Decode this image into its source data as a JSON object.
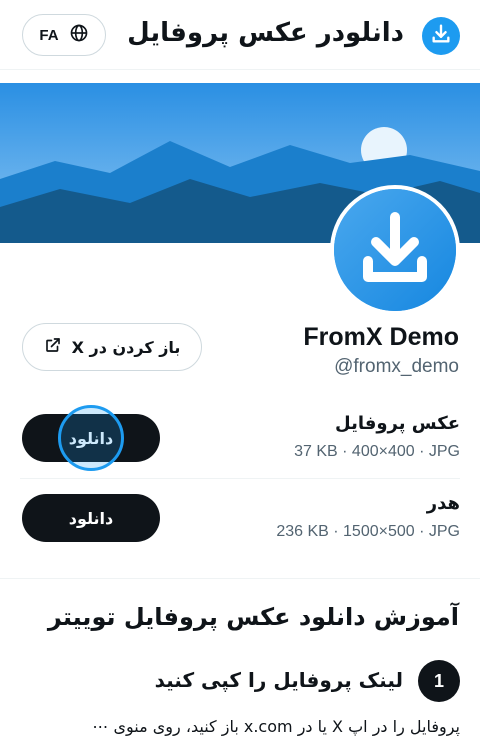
{
  "header": {
    "lang_label": "FA",
    "lang_icon": "globe-icon",
    "title": "دانلودر عکس پروفایل",
    "logo_icon": "download-icon"
  },
  "profile": {
    "name": "FromX Demo",
    "handle": "@fromx_demo",
    "open_button_label": "باز کردن در X",
    "open_button_icon": "external-link-icon"
  },
  "downloads": [
    {
      "title": "عکس پروفایل",
      "meta": "37 KB · 400×400 · JPG",
      "button_label": "دانلود"
    },
    {
      "title": "هدر",
      "meta": "236 KB · 1500×500 · JPG",
      "button_label": "دانلود"
    }
  ],
  "tutorial": {
    "title": "آموزش دانلود عکس پروفایل توییتر",
    "steps": [
      {
        "number": "1",
        "title": "لینک پروفایل را کپی کنید",
        "body": "پروفایل را در اپ X یا در x.com باز کنید، روی منوی ⋯"
      }
    ]
  },
  "colors": {
    "accent": "#1d9bf0",
    "primary_text": "#0f1419",
    "secondary_text": "#536471",
    "button_dark": "#0f1419"
  }
}
